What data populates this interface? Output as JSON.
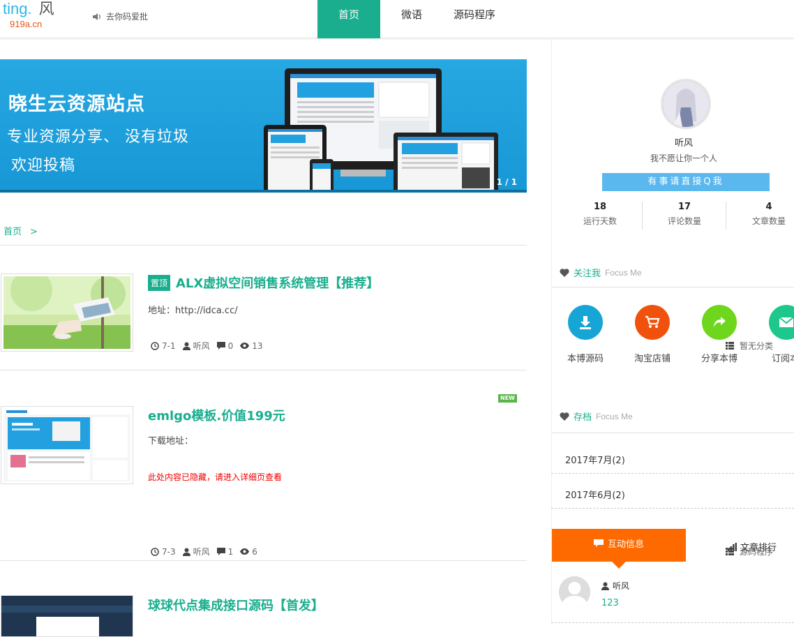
{
  "header": {
    "logo_text": "ting.",
    "logo_char": "风",
    "logo_domain": "919a.cn",
    "notice": "去你码爱批",
    "nav": [
      {
        "label": "首页"
      },
      {
        "label": "微语"
      },
      {
        "label": "源码程序"
      }
    ]
  },
  "banner": {
    "line1": "晓生云资源站点",
    "line2": "专业资源分享、 没有垃圾",
    "line3": "欢迎投稿",
    "pager": "1 / 1"
  },
  "breadcrumb": {
    "home": "首页",
    "sep": ">"
  },
  "posts": [
    {
      "badge": "置顶",
      "title": "ALX虚拟空间销售系统管理【推荐】",
      "desc": "地址：http://idca.cc/",
      "date": "7-1",
      "author": "听风",
      "comments": "0",
      "views": "13",
      "category": "暂无分类"
    },
    {
      "new_tag": "NEW",
      "title": "emlgo模板.价值199元",
      "desc": "下载地址：",
      "hidden_note": "此处内容已隐藏，请进入详细页查看",
      "date": "7-3",
      "author": "听风",
      "comments": "1",
      "views": "6",
      "category": "源码程序"
    },
    {
      "title": "球球代点集成接口源码【首发】"
    }
  ],
  "sidebar": {
    "profile": {
      "name": "听风",
      "signature": "我不愿让你一个人",
      "contact_button": "有事请直接Q我"
    },
    "stats": [
      {
        "value": "18",
        "label": "运行天数"
      },
      {
        "value": "17",
        "label": "评论数量"
      },
      {
        "value": "4",
        "label": "文章数量"
      }
    ],
    "follow": {
      "title": "关注我",
      "subtitle": "Focus Me",
      "items": [
        {
          "label": "本博源码",
          "icon": "download-icon",
          "color": "#17a5d6"
        },
        {
          "label": "淘宝店铺",
          "icon": "cart-icon",
          "color": "#f0520e"
        },
        {
          "label": "分享本博",
          "icon": "share-icon",
          "color": "#6ed61c"
        },
        {
          "label": "订阅本",
          "icon": "mail-icon",
          "color": "#1ec88c"
        }
      ]
    },
    "archive": {
      "title": "存档",
      "subtitle": "Focus Me",
      "items": [
        "2017年7月(2)",
        "2017年6月(2)"
      ]
    },
    "tabs": {
      "active": "互动信息",
      "other": "文章排行"
    },
    "comment": {
      "author": "听风",
      "text": "123"
    }
  },
  "colors": {
    "accent": "#1aae8e",
    "orange": "#ff6a00",
    "banner_blue": "#1b9edb"
  }
}
